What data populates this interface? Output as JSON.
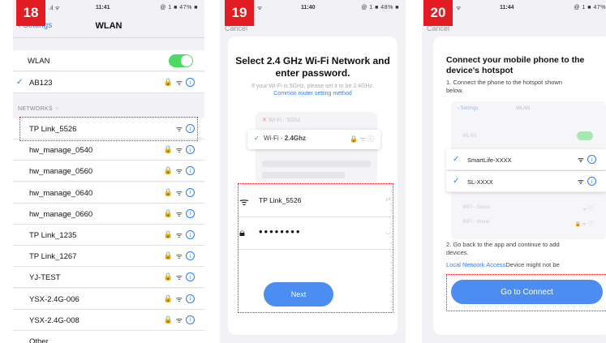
{
  "colors": {
    "accent": "#2f7cf6",
    "badge": "#e31b23",
    "toggle_on": "#4cd964",
    "button": "#4d8df2"
  },
  "panel1": {
    "step": "18",
    "status": {
      "time": "11:41",
      "battery": "@ 1 ■ 47% ■"
    },
    "back_label": "Settings",
    "title": "WLAN",
    "wlan_label": "WLAN",
    "connected": "AB123",
    "networks_header": "NETWORKS",
    "networks": [
      {
        "name": "TP Link_5526",
        "locked": false
      },
      {
        "name": "hw_manage_0540",
        "locked": true
      },
      {
        "name": "hw_manage_0560",
        "locked": true
      },
      {
        "name": "hw_manage_0640",
        "locked": true
      },
      {
        "name": "hw_manage_0660",
        "locked": true
      },
      {
        "name": "TP Link_1235",
        "locked": true
      },
      {
        "name": "TP Link_1267",
        "locked": true
      },
      {
        "name": "YJ-TEST",
        "locked": true
      },
      {
        "name": "YSX-2.4G-006",
        "locked": true
      },
      {
        "name": "YSX-2.4G-008",
        "locked": true
      },
      {
        "name": "Other...",
        "locked": false
      }
    ]
  },
  "panel2": {
    "step": "19",
    "status": {
      "time": "11:40",
      "battery": "@ 1 ■ 48% ■"
    },
    "cancel": "Cancel",
    "title": "Select 2.4 GHz Wi-Fi Network and enter password.",
    "subtitle": "If your Wi-Fi is 5GHz, please set it to be 2.4GHz.",
    "router_link": "Common router setting method",
    "mini_5g": "Wi-Fi - 5Ghz",
    "mini_24_prefix": "Wi-Fi - ",
    "mini_24_band": "2.4Ghz",
    "ssid": "TP Link_5526",
    "password_mask": "••••••••",
    "next": "Next"
  },
  "panel3": {
    "step": "20",
    "status": {
      "time": "11:44",
      "battery": "@ 1 ■ 47% "
    },
    "cancel": "Cancel",
    "title": "Connect your mobile phone to the device's hotspot",
    "instruction1": "1. Connect the phone to the hotspot shown below.",
    "mini_back": "Settings",
    "mini_title": "WLAN",
    "mini_wlan": "WLAN",
    "hotspots": [
      "SmartLife-XXXX",
      "SL-XXXX"
    ],
    "faded": [
      "WiFi - Guest",
      "WiFi - Home"
    ],
    "instruction2": "2. Go back to the app and continue to add devices.",
    "local_link": "Local Network Access",
    "local_rest": "Device might not be",
    "go_button": "Go to Connect"
  }
}
